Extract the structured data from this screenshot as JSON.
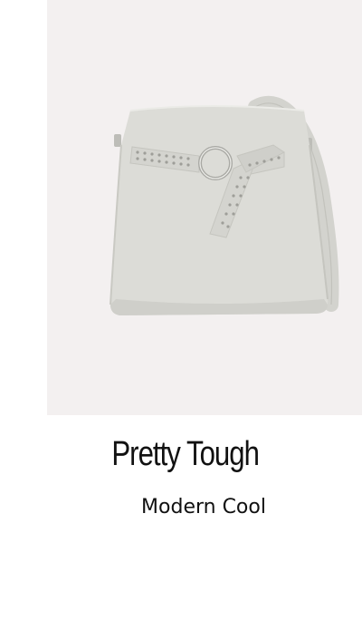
{
  "product": {
    "title": "Pretty Tough",
    "subtitle": "Modern Cool",
    "image_icon": "handbag-image"
  },
  "colors": {
    "image_background": "#f3f0f0",
    "bag": "#dcdcd7",
    "text": "#111111"
  }
}
